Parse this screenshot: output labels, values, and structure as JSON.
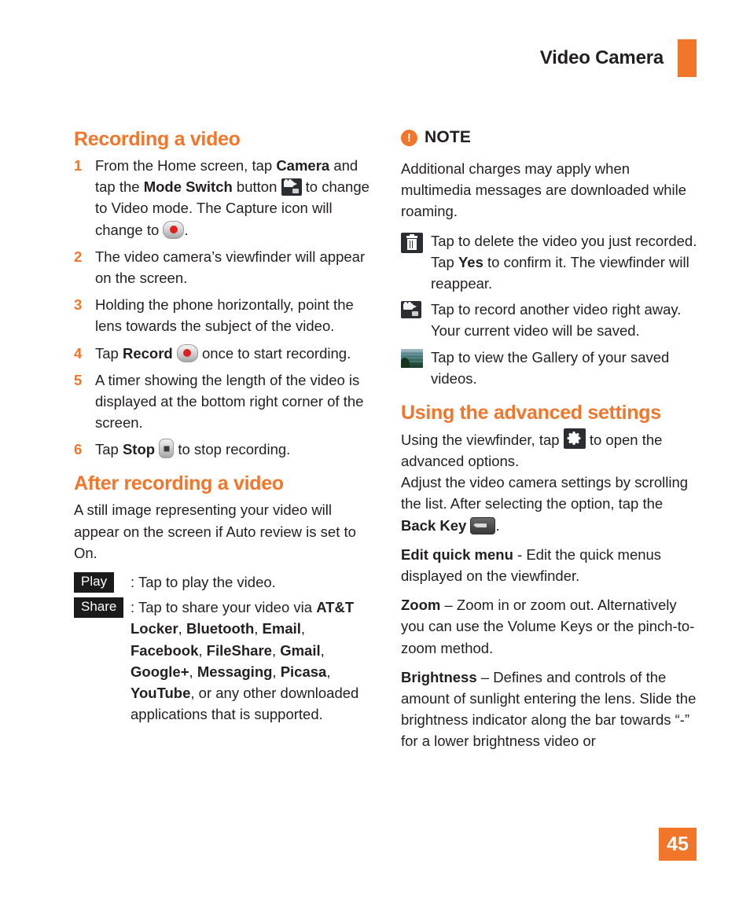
{
  "header": {
    "title": "Video Camera"
  },
  "colors": {
    "accent_orange": "#F1762A",
    "body_text": "#231f20",
    "chip_background": "#1b1b1b",
    "record_dot_red": "#e02020"
  },
  "left_column": {
    "section1_heading": "Recording a video",
    "steps": [
      {
        "num": "1",
        "part1": "From the Home screen, tap ",
        "bold1": "Camera",
        "part2": " and tap the ",
        "bold2": "Mode Switch",
        "part3": " button ",
        "icon1": "mode-switch-camcorder-icon",
        "part4": " to change to Video mode. The Capture icon will change to ",
        "icon2": "record-button-icon",
        "part5": "."
      },
      {
        "num": "2",
        "text": "The video camera’s viewfinder will appear on the screen."
      },
      {
        "num": "3",
        "text": "Holding the phone horizontally, point the lens towards the subject of the video."
      },
      {
        "num": "4",
        "part1": "Tap ",
        "bold1": "Record",
        "part2": " ",
        "icon1": "record-button-icon",
        "part3": " once to start recording."
      },
      {
        "num": "5",
        "text": "A timer showing the length of the video is displayed at the bottom right corner of the screen."
      },
      {
        "num": "6",
        "part1": "Tap ",
        "bold1": "Stop",
        "part2": " ",
        "icon1": "stop-button-icon",
        "part3": " to stop recording."
      }
    ],
    "section2_heading": "After recording a video",
    "section2_intro": "A still image representing your video will appear on the screen if Auto review is set to On.",
    "actions": [
      {
        "chip": "Play",
        "text": ": Tap to play the video."
      },
      {
        "chip": "Share",
        "prefix": ": Tap to share your video via ",
        "apps": [
          "AT&T Locker",
          "Bluetooth",
          "Email",
          "Facebook",
          "FileShare",
          "Gmail",
          "Google+",
          "Messaging",
          "Picasa",
          "YouTube"
        ],
        "suffix": ", or any other downloaded applications that is supported."
      }
    ]
  },
  "right_column": {
    "note_label": "NOTE",
    "note_icon": "exclamation-circle-icon",
    "note_body": "Additional charges may apply when multimedia messages are downloaded while roaming.",
    "icon_items": [
      {
        "icon": "trash-can-icon",
        "part1": "Tap to delete the video you just recorded. Tap ",
        "bold1": "Yes",
        "part2": " to confirm it. The viewfinder will reappear."
      },
      {
        "icon": "camcorder-icon",
        "text": "Tap to record another video right away. Your current video will be saved."
      },
      {
        "icon": "gallery-thumbnail-icon",
        "text": "Tap to view the Gallery of your saved videos."
      }
    ],
    "section_heading": "Using the advanced settings",
    "intro_part1": "Using the viewfinder, tap ",
    "intro_icon": "gear-icon",
    "intro_part2": " to open the advanced options.",
    "intro_line2_part1": "Adjust the video camera settings by scrolling the list. After selecting the option, tap the ",
    "intro_line2_bold": "Back Key",
    "intro_line2_icon": "back-key-icon",
    "intro_line2_part2": ".",
    "settings": [
      {
        "term": "Edit quick menu",
        "desc": " - Edit the quick menus displayed on the viewfinder."
      },
      {
        "term": "Zoom",
        "desc": " – Zoom in or zoom out. Alternatively you can use the Volume Keys or the pinch-to-zoom method."
      },
      {
        "term": "Brightness",
        "desc": " – Defines and controls of the amount of sunlight entering the lens. Slide the brightness indicator along the bar towards “-” for a lower brightness video or"
      }
    ]
  },
  "folio": {
    "page_number": "45"
  }
}
